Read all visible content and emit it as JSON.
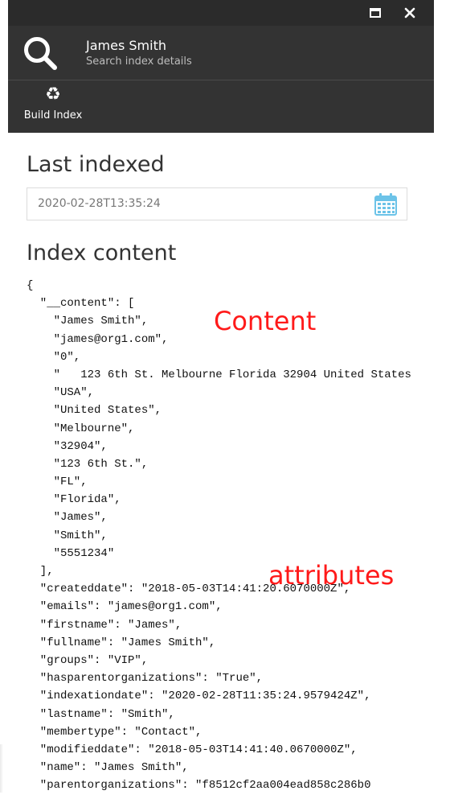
{
  "window": {
    "maximize_icon": "maximize-icon",
    "close_icon": "close-icon"
  },
  "header": {
    "title": "James Smith",
    "subtitle": "Search index details",
    "icon": "search-icon"
  },
  "toolbar": {
    "build_index_label": "Build Index",
    "build_index_icon": "recycle-icon"
  },
  "last_indexed": {
    "title": "Last indexed",
    "date_value": "2020-02-28T13:35:24",
    "calendar_icon": "calendar-icon"
  },
  "index_content": {
    "title": "Index content",
    "lines": [
      "{",
      "  \"__content\": [",
      "    \"James Smith\",",
      "    \"james@org1.com\",",
      "    \"0\",",
      "    \"   123 6th St. Melbourne Florida 32904 United States",
      "    \"USA\",",
      "    \"United States\",",
      "    \"Melbourne\",",
      "    \"32904\",",
      "    \"123 6th St.\",",
      "    \"FL\",",
      "    \"Florida\",",
      "    \"James\",",
      "    \"Smith\",",
      "    \"5551234\"",
      "  ],",
      "  \"createddate\": \"2018-05-03T14:41:20.6070000Z\",",
      "  \"emails\": \"james@org1.com\",",
      "  \"firstname\": \"James\",",
      "  \"fullname\": \"James Smith\",",
      "  \"groups\": \"VIP\",",
      "  \"hasparentorganizations\": \"True\",",
      "  \"indexationdate\": \"2020-02-28T11:35:24.9579424Z\",",
      "  \"lastname\": \"Smith\",",
      "  \"membertype\": \"Contact\",",
      "  \"modifieddate\": \"2018-05-03T14:41:40.0670000Z\",",
      "  \"name\": \"James Smith\",",
      "  \"parentorganizations\": \"f8512cf2aa004ead858c286b0"
    ]
  },
  "annotations": {
    "content": "Content",
    "attributes": "attributes",
    "color": "#ff1a1a"
  },
  "colors": {
    "header_bg": "#333333",
    "window_bar_bg": "#2b2b2b",
    "calendar_icon": "#6cc3e8"
  }
}
